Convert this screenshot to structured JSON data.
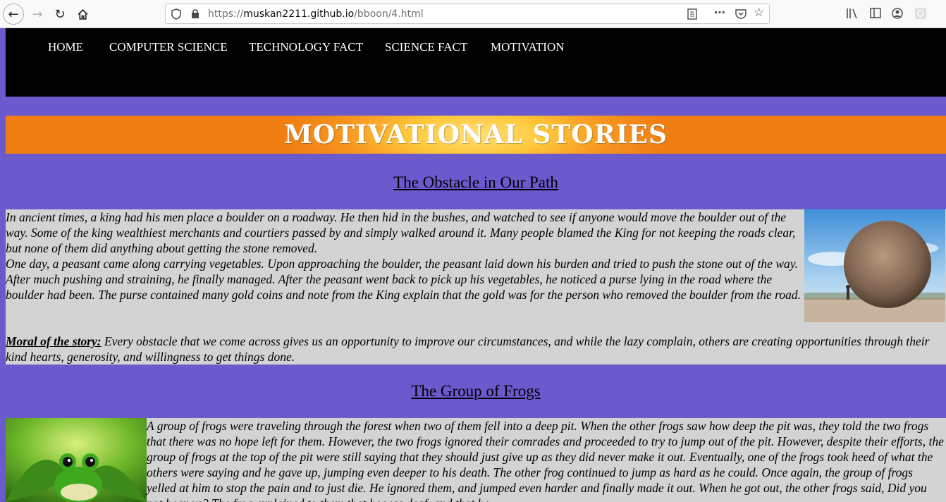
{
  "browser": {
    "url_prefix": "https://",
    "url_domain": "muskan2211.github.io",
    "url_path": "/bboon/4.html"
  },
  "nav": {
    "items": [
      "HOME",
      "COMPUTER SCIENCE",
      "TECHNOLOGY FACT",
      "SCIENCE FACT",
      "MOTIVATION"
    ]
  },
  "banner": {
    "title": "MOTIVATIONAL STORIES",
    "colors": {
      "center": "#ffe07a",
      "edge": "#f07d10"
    }
  },
  "story1": {
    "title": "The Obstacle in Our Path",
    "paragraph1": "In ancient times, a king had his men place a boulder on a roadway. He then hid in the bushes, and watched to see if anyone would move the boulder out of the way. Some of the king wealthiest merchants and courtiers passed by and simply walked around it. Many people blamed the King for not keeping the roads clear, but none of them did anything about getting the stone removed.",
    "paragraph2": "One day, a peasant came along carrying vegetables. Upon approaching the boulder, the peasant laid down his burden and tried to push the stone out of the way. After much pushing and straining, he finally managed. After the peasant went back to pick up his vegetables, he noticed a purse lying in the road where the boulder had been. The purse contained many gold coins and note from the King explain that the gold was for the person who removed the boulder from the road.",
    "moral_label": "Moral of the story:",
    "moral_text": " Every obstacle that we come across gives us an opportunity to improve our circumstances, and while the lazy complain, others are creating opportunities through their kind hearts, generosity, and willingness to get things done."
  },
  "story2": {
    "title": "The Group of Frogs",
    "paragraph1": "A group of frogs were traveling through the forest when two of them fell into a deep pit. When the other frogs saw how deep the pit was, they told the two frogs that there was no hope left for them. However, the two frogs ignored their comrades and proceeded to try to jump out of the pit. However, despite their efforts, the group of frogs at the top of the pit were still saying that they should just give up as they did never make it out. Eventually, one of the frogs took heed of what the others were saying and he gave up, jumping even deeper to his death. The other frog continued to jump as hard as he could. Once again, the group of frogs yelled at him to stop the pain and to just die. He ignored them, and jumped even harder and finally made it out. When he got out, the other frogs said, Did you not hear us? The frog explained to them that he was deaf, and that he"
  },
  "colors": {
    "page_bg": "#6a5acd",
    "nav_bg": "#000000",
    "story_bg": "#d3d3d3"
  }
}
